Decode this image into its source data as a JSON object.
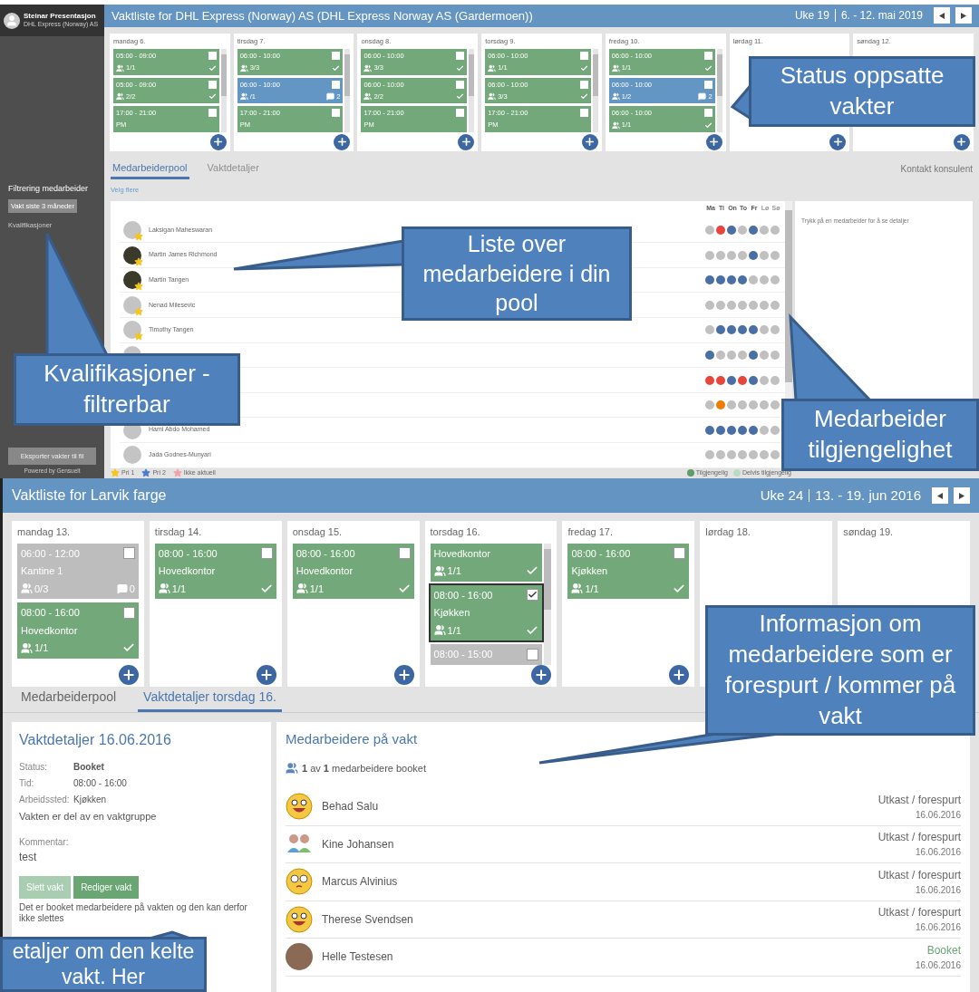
{
  "top": {
    "user": {
      "name": "Steinar Presentasjon",
      "company": "DHL Express (Norway) AS"
    },
    "sidebar": {
      "filter_title": "Filtrering medarbeider",
      "filter_button": "Vakt siste 3 måneder",
      "qualifications": "Kvalifikasjoner",
      "export_button": "Eksporter vakter til fil",
      "powered_by": "Powered by Gensuelt"
    },
    "title": "Vaktliste for DHL Express (Norway) AS (DHL Express Norway AS (Gardermoen))",
    "week": "Uke 19",
    "range": "6. - 12. mai 2019",
    "days": [
      {
        "label": "mandag 6.",
        "shifts": [
          {
            "kind": "booked",
            "time": "05:00 - 09:00",
            "count": "1/1",
            "confirmed": true,
            "checked": false
          },
          {
            "kind": "booked",
            "time": "05:00 - 09:00",
            "count": "2/2",
            "confirmed": true,
            "checked": false
          },
          {
            "kind": "booked",
            "time": "17:00 - 21:00",
            "place": "PM",
            "checked": false
          }
        ]
      },
      {
        "label": "tirsdag 7.",
        "shifts": [
          {
            "kind": "booked",
            "time": "06:00 - 10:00",
            "count": "3/3",
            "confirmed": true,
            "checked": false
          },
          {
            "kind": "requested",
            "time": "06:00 - 10:00",
            "count": "/1",
            "comments": "2",
            "checked": false
          },
          {
            "kind": "booked",
            "time": "17:00 - 21:00",
            "place": "PM",
            "checked": false
          }
        ]
      },
      {
        "label": "onsdag 8.",
        "shifts": [
          {
            "kind": "booked",
            "time": "06:00 - 10:00",
            "count": "3/3",
            "confirmed": true,
            "checked": false
          },
          {
            "kind": "booked",
            "time": "06:00 - 10:00",
            "count": "2/2",
            "confirmed": true,
            "checked": false
          },
          {
            "kind": "booked",
            "time": "17:00 - 21:00",
            "place": "PM",
            "checked": false
          }
        ]
      },
      {
        "label": "torsdag 9.",
        "shifts": [
          {
            "kind": "booked",
            "time": "06:00 - 10:00",
            "count": "1/1",
            "confirmed": true,
            "checked": false
          },
          {
            "kind": "booked",
            "time": "06:00 - 10:00",
            "count": "3/3",
            "confirmed": true,
            "checked": false
          },
          {
            "kind": "booked",
            "time": "17:00 - 21:00",
            "place": "PM",
            "checked": false
          }
        ]
      },
      {
        "label": "fredag 10.",
        "shifts": [
          {
            "kind": "booked",
            "time": "06:00 - 10:00",
            "count": "1/1",
            "confirmed": true,
            "checked": false
          },
          {
            "kind": "requested",
            "time": "06:00 - 10:00",
            "count": "1/2",
            "comments": "2",
            "checked": false
          },
          {
            "kind": "booked",
            "time": "06:00 - 10:00",
            "count": "1/1",
            "confirmed": true,
            "checked": false
          }
        ]
      },
      {
        "label": "lørdag 11."
      },
      {
        "label": "søndag 12."
      }
    ],
    "tabs": [
      {
        "label": "Medarbeiderpool",
        "selected": true
      },
      {
        "label": "Vaktdetaljer",
        "selected": false
      }
    ],
    "contact": "Kontakt konsulent",
    "select_more": "Velg flere",
    "weekdays": [
      "Ma",
      "Ti",
      "On",
      "To",
      "Fr",
      "Lø",
      "Sø"
    ],
    "employees": [
      {
        "name": "Laksigan Maheswaran",
        "photo": false,
        "star": true,
        "availability": [
          {
            "color": "#c0c0c0"
          },
          {
            "color": "#e8453c"
          },
          {
            "color": "#4a6fa5"
          },
          {
            "color": "#c0c0c0"
          },
          {
            "color": "#4a6fa5"
          },
          {
            "color": "#c0c0c0"
          },
          {
            "color": "#c0c0c0"
          }
        ]
      },
      {
        "name": "Martin James Richmond",
        "photo": true,
        "star": true,
        "availability": [
          {
            "color": "#c0c0c0"
          },
          {
            "color": "#c0c0c0"
          },
          {
            "color": "#c0c0c0"
          },
          {
            "color": "#c0c0c0"
          },
          {
            "color": "#4a6fa5"
          },
          {
            "color": "#c0c0c0"
          },
          {
            "color": "#c0c0c0"
          }
        ]
      },
      {
        "name": "Martin Tangen",
        "photo": true,
        "star": true,
        "availability": [
          {
            "color": "#4a6fa5"
          },
          {
            "color": "#4a6fa5"
          },
          {
            "color": "#4a6fa5"
          },
          {
            "color": "#4a6fa5"
          },
          {
            "color": "#c0c0c0"
          },
          {
            "color": "#c0c0c0"
          },
          {
            "color": "#c0c0c0"
          }
        ]
      },
      {
        "name": "Nenad Milesevic",
        "photo": false,
        "star": true,
        "availability": [
          {
            "color": "#c0c0c0"
          },
          {
            "color": "#c0c0c0"
          },
          {
            "color": "#c0c0c0"
          },
          {
            "color": "#c0c0c0"
          },
          {
            "color": "#c0c0c0"
          },
          {
            "color": "#c0c0c0"
          },
          {
            "color": "#c0c0c0"
          }
        ]
      },
      {
        "name": "Timothy Tangen",
        "photo": false,
        "star": true,
        "availability": [
          {
            "color": "#c0c0c0"
          },
          {
            "color": "#4a6fa5"
          },
          {
            "color": "#4a6fa5"
          },
          {
            "color": "#4a6fa5"
          },
          {
            "color": "#4a6fa5"
          },
          {
            "color": "#c0c0c0"
          },
          {
            "color": "#c0c0c0"
          }
        ]
      },
      {
        "availability": [
          {
            "color": "#4a6fa5"
          },
          {
            "color": "#c0c0c0"
          },
          {
            "color": "#c0c0c0"
          },
          {
            "color": "#c0c0c0"
          },
          {
            "color": "#4a6fa5"
          },
          {
            "color": "#c0c0c0"
          },
          {
            "color": "#c0c0c0"
          }
        ]
      },
      {
        "availability": [
          {
            "color": "#e8453c"
          },
          {
            "color": "#e8453c"
          },
          {
            "color": "#4a6fa5"
          },
          {
            "color": "#e8453c"
          },
          {
            "color": "#4a6fa5"
          },
          {
            "color": "#c0c0c0"
          },
          {
            "color": "#c0c0c0"
          }
        ]
      },
      {
        "availability": [
          {
            "color": "#c0c0c0"
          },
          {
            "color": "#f07c00"
          },
          {
            "color": "#c0c0c0"
          },
          {
            "color": "#c0c0c0"
          },
          {
            "color": "#c0c0c0"
          },
          {
            "color": "#c0c0c0"
          },
          {
            "color": "#c0c0c0"
          }
        ]
      },
      {
        "name": "Hami Abdo Mohamed",
        "photo": false,
        "availability": [
          {
            "color": "#4a6fa5"
          },
          {
            "color": "#4a6fa5"
          },
          {
            "color": "#4a6fa5"
          },
          {
            "color": "#4a6fa5"
          },
          {
            "color": "#4a6fa5"
          },
          {
            "color": "#c0c0c0"
          },
          {
            "color": "#c0c0c0"
          }
        ]
      },
      {
        "name": "Jada Godnes-Munyari",
        "photo": false,
        "availability": [
          {
            "color": "#c0c0c0"
          },
          {
            "color": "#c0c0c0"
          },
          {
            "color": "#c0c0c0"
          },
          {
            "color": "#c0c0c0"
          },
          {
            "color": "#c0c0c0"
          },
          {
            "color": "#c0c0c0"
          },
          {
            "color": "#c0c0c0"
          }
        ]
      }
    ],
    "detail_hint": "Trykk på en medarbeider for å se detaljer",
    "legend_priority": [
      {
        "label": "Pri 1",
        "color": "#f5c518"
      },
      {
        "label": "Pri 2",
        "color": "#4a7cc9"
      },
      {
        "label": "Ikke aktuell",
        "color": "#f4a0a8"
      }
    ],
    "legend_availability": [
      {
        "label": "Tilgjengelig",
        "color": "#5f9c6a"
      },
      {
        "label": "Delvis tilgjengelig",
        "color": "#b9dcc0"
      }
    ]
  },
  "bottom": {
    "title": "Vaktliste for Larvik farge",
    "week": "Uke 24",
    "range": "13. - 19. jun 2016",
    "days": [
      {
        "label": "mandag 13.",
        "shifts": [
          {
            "kind": "draft",
            "time": "06:00 - 12:00",
            "place": "Kantine 1",
            "count": "0/3",
            "comments": "0",
            "checked": false,
            "selected": false
          },
          {
            "kind": "booked",
            "time": "08:00 - 16:00",
            "place": "Hovedkontor",
            "count": "1/1",
            "confirmed": true,
            "checked": false,
            "selected": false
          }
        ]
      },
      {
        "label": "tirsdag 14.",
        "shifts": [
          {
            "kind": "booked",
            "time": "08:00 - 16:00",
            "place": "Hovedkontor",
            "count": "1/1",
            "confirmed": true,
            "checked": false,
            "selected": false
          }
        ]
      },
      {
        "label": "onsdag 15.",
        "shifts": [
          {
            "kind": "booked",
            "time": "08:00 - 16:00",
            "place": "Hovedkontor",
            "count": "1/1",
            "confirmed": true,
            "checked": false,
            "selected": false
          }
        ]
      },
      {
        "label": "torsdag 16.",
        "shifts": [
          {
            "kind": "booked",
            "place": "Hovedkontor",
            "count": "1/1",
            "confirmed": true,
            "selected": false
          },
          {
            "kind": "booked",
            "time": "08:00 - 16:00",
            "place": "Kjøkken",
            "count": "1/1",
            "confirmed": true,
            "checked": true,
            "selected": true
          },
          {
            "kind": "draft",
            "time": "08:00 - 15:00",
            "checked": false,
            "selected": false
          }
        ]
      },
      {
        "label": "fredag 17.",
        "shifts": [
          {
            "kind": "booked",
            "time": "08:00 - 16:00",
            "place": "Kjøkken",
            "count": "1/1",
            "confirmed": true,
            "checked": false,
            "selected": false
          }
        ]
      },
      {
        "label": "lørdag 18."
      },
      {
        "label": "søndag 19."
      }
    ],
    "tabs": [
      {
        "label": "Medarbeiderpool",
        "selected": false
      },
      {
        "label": "Vaktdetaljer torsdag 16.",
        "selected": true
      }
    ],
    "details": {
      "title": "Vaktdetaljer 16.06.2016",
      "fields": [
        {
          "label": "Status:",
          "value": "Booket",
          "bold": true
        },
        {
          "label": "Tid:",
          "value": "08:00 - 16:00",
          "bold": false
        },
        {
          "label": "Arbeidssted:",
          "value": "Kjøkken",
          "bold": false
        }
      ],
      "group_note": "Vakten er del av en vaktgruppe",
      "comment_label": "Kommentar:",
      "comment": "test",
      "buttons": [
        {
          "label": "Slett vakt",
          "disabled": true
        },
        {
          "label": "Rediger vakt",
          "disabled": false
        }
      ],
      "note": "Det er booket medarbeidere på vakten og den kan derfor ikke slettes"
    },
    "staff": {
      "title": "Medarbeidere på vakt",
      "summary": "**1** av **1** medarbeidere booket",
      "people": [
        {
          "name": "Behad Salu",
          "avatar": {
            "kind": "smiley"
          },
          "status": "Utkast / forespurt",
          "kind": "draft",
          "date": "16.06.2016"
        },
        {
          "name": "Kine Johansen",
          "avatar": {
            "kind": "group"
          },
          "status": "Utkast / forespurt",
          "kind": "draft",
          "date": "16.06.2016"
        },
        {
          "name": "Marcus Alvinius",
          "avatar": {
            "kind": "glasses"
          },
          "status": "Utkast / forespurt",
          "kind": "draft",
          "date": "16.06.2016"
        },
        {
          "name": "Therese Svendsen",
          "avatar": {
            "kind": "smiley"
          },
          "status": "Utkast / forespurt",
          "kind": "draft",
          "date": "16.06.2016"
        },
        {
          "name": "Helle Testesen",
          "avatar": {
            "kind": "photo"
          },
          "status": "Booket",
          "kind": "booked",
          "date": "16.06.2016"
        }
      ]
    }
  },
  "callouts": [
    "Status oppsatte vakter",
    "Liste over medarbeidere i din pool",
    "Kvalifikasjoner - filtrerbar",
    "Medarbeider tilgjengelighet",
    "Informasjon om medarbeidere som er forespurt / kommer på vakt",
    "etaljer om den kelte vakt. Her"
  ]
}
